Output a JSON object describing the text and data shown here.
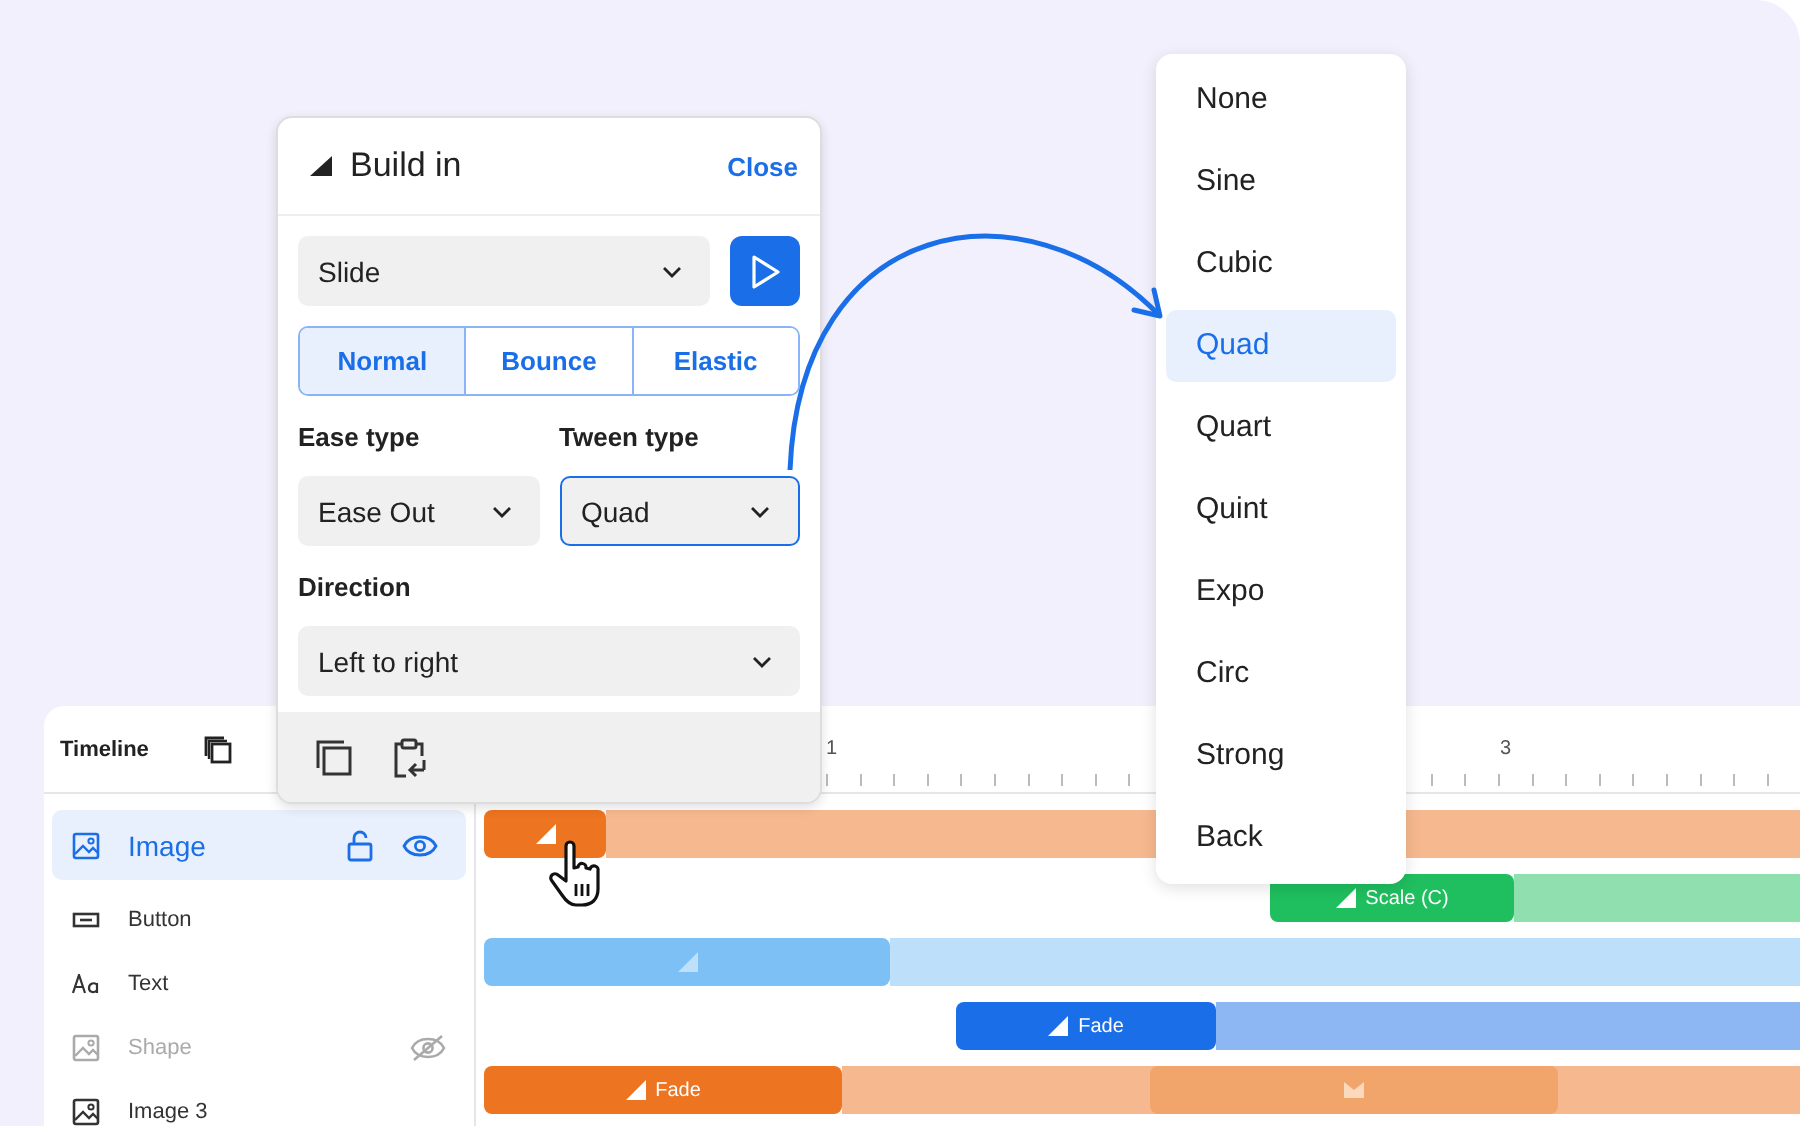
{
  "panel": {
    "title": "Build in",
    "close": "Close",
    "effect": "Slide",
    "modes": [
      {
        "label": "Normal",
        "selected": true
      },
      {
        "label": "Bounce",
        "selected": false
      },
      {
        "label": "Elastic",
        "selected": false
      }
    ],
    "ease_label": "Ease type",
    "ease_value": "Ease Out",
    "tween_label": "Tween type",
    "tween_value": "Quad",
    "direction_label": "Direction",
    "direction_value": "Left to right"
  },
  "tween_menu": [
    {
      "label": "None",
      "selected": false
    },
    {
      "label": "Sine",
      "selected": false
    },
    {
      "label": "Cubic",
      "selected": false
    },
    {
      "label": "Quad",
      "selected": true
    },
    {
      "label": "Quart",
      "selected": false
    },
    {
      "label": "Quint",
      "selected": false
    },
    {
      "label": "Expo",
      "selected": false
    },
    {
      "label": "Circ",
      "selected": false
    },
    {
      "label": "Strong",
      "selected": false
    },
    {
      "label": "Back",
      "selected": false
    }
  ],
  "timeline": {
    "title": "Timeline",
    "ruler": [
      "1",
      "3"
    ],
    "layers": [
      {
        "name": "Image",
        "kind": "image",
        "selected": true,
        "visible": true,
        "color": "#ed7420"
      },
      {
        "name": "Button",
        "kind": "button",
        "selected": false,
        "visible": true,
        "color": "#1fbf5f",
        "bar_label": "Scale (C)"
      },
      {
        "name": "Text",
        "kind": "text",
        "selected": false,
        "visible": true,
        "color": "#7cc0f5"
      },
      {
        "name": "Shape",
        "kind": "image",
        "selected": false,
        "visible": false,
        "color": "#1a6fe8",
        "bar_label": "Fade"
      },
      {
        "name": "Image 3",
        "kind": "image",
        "selected": false,
        "visible": true,
        "color": "#ed7420",
        "bar_label": "Fade"
      }
    ]
  }
}
